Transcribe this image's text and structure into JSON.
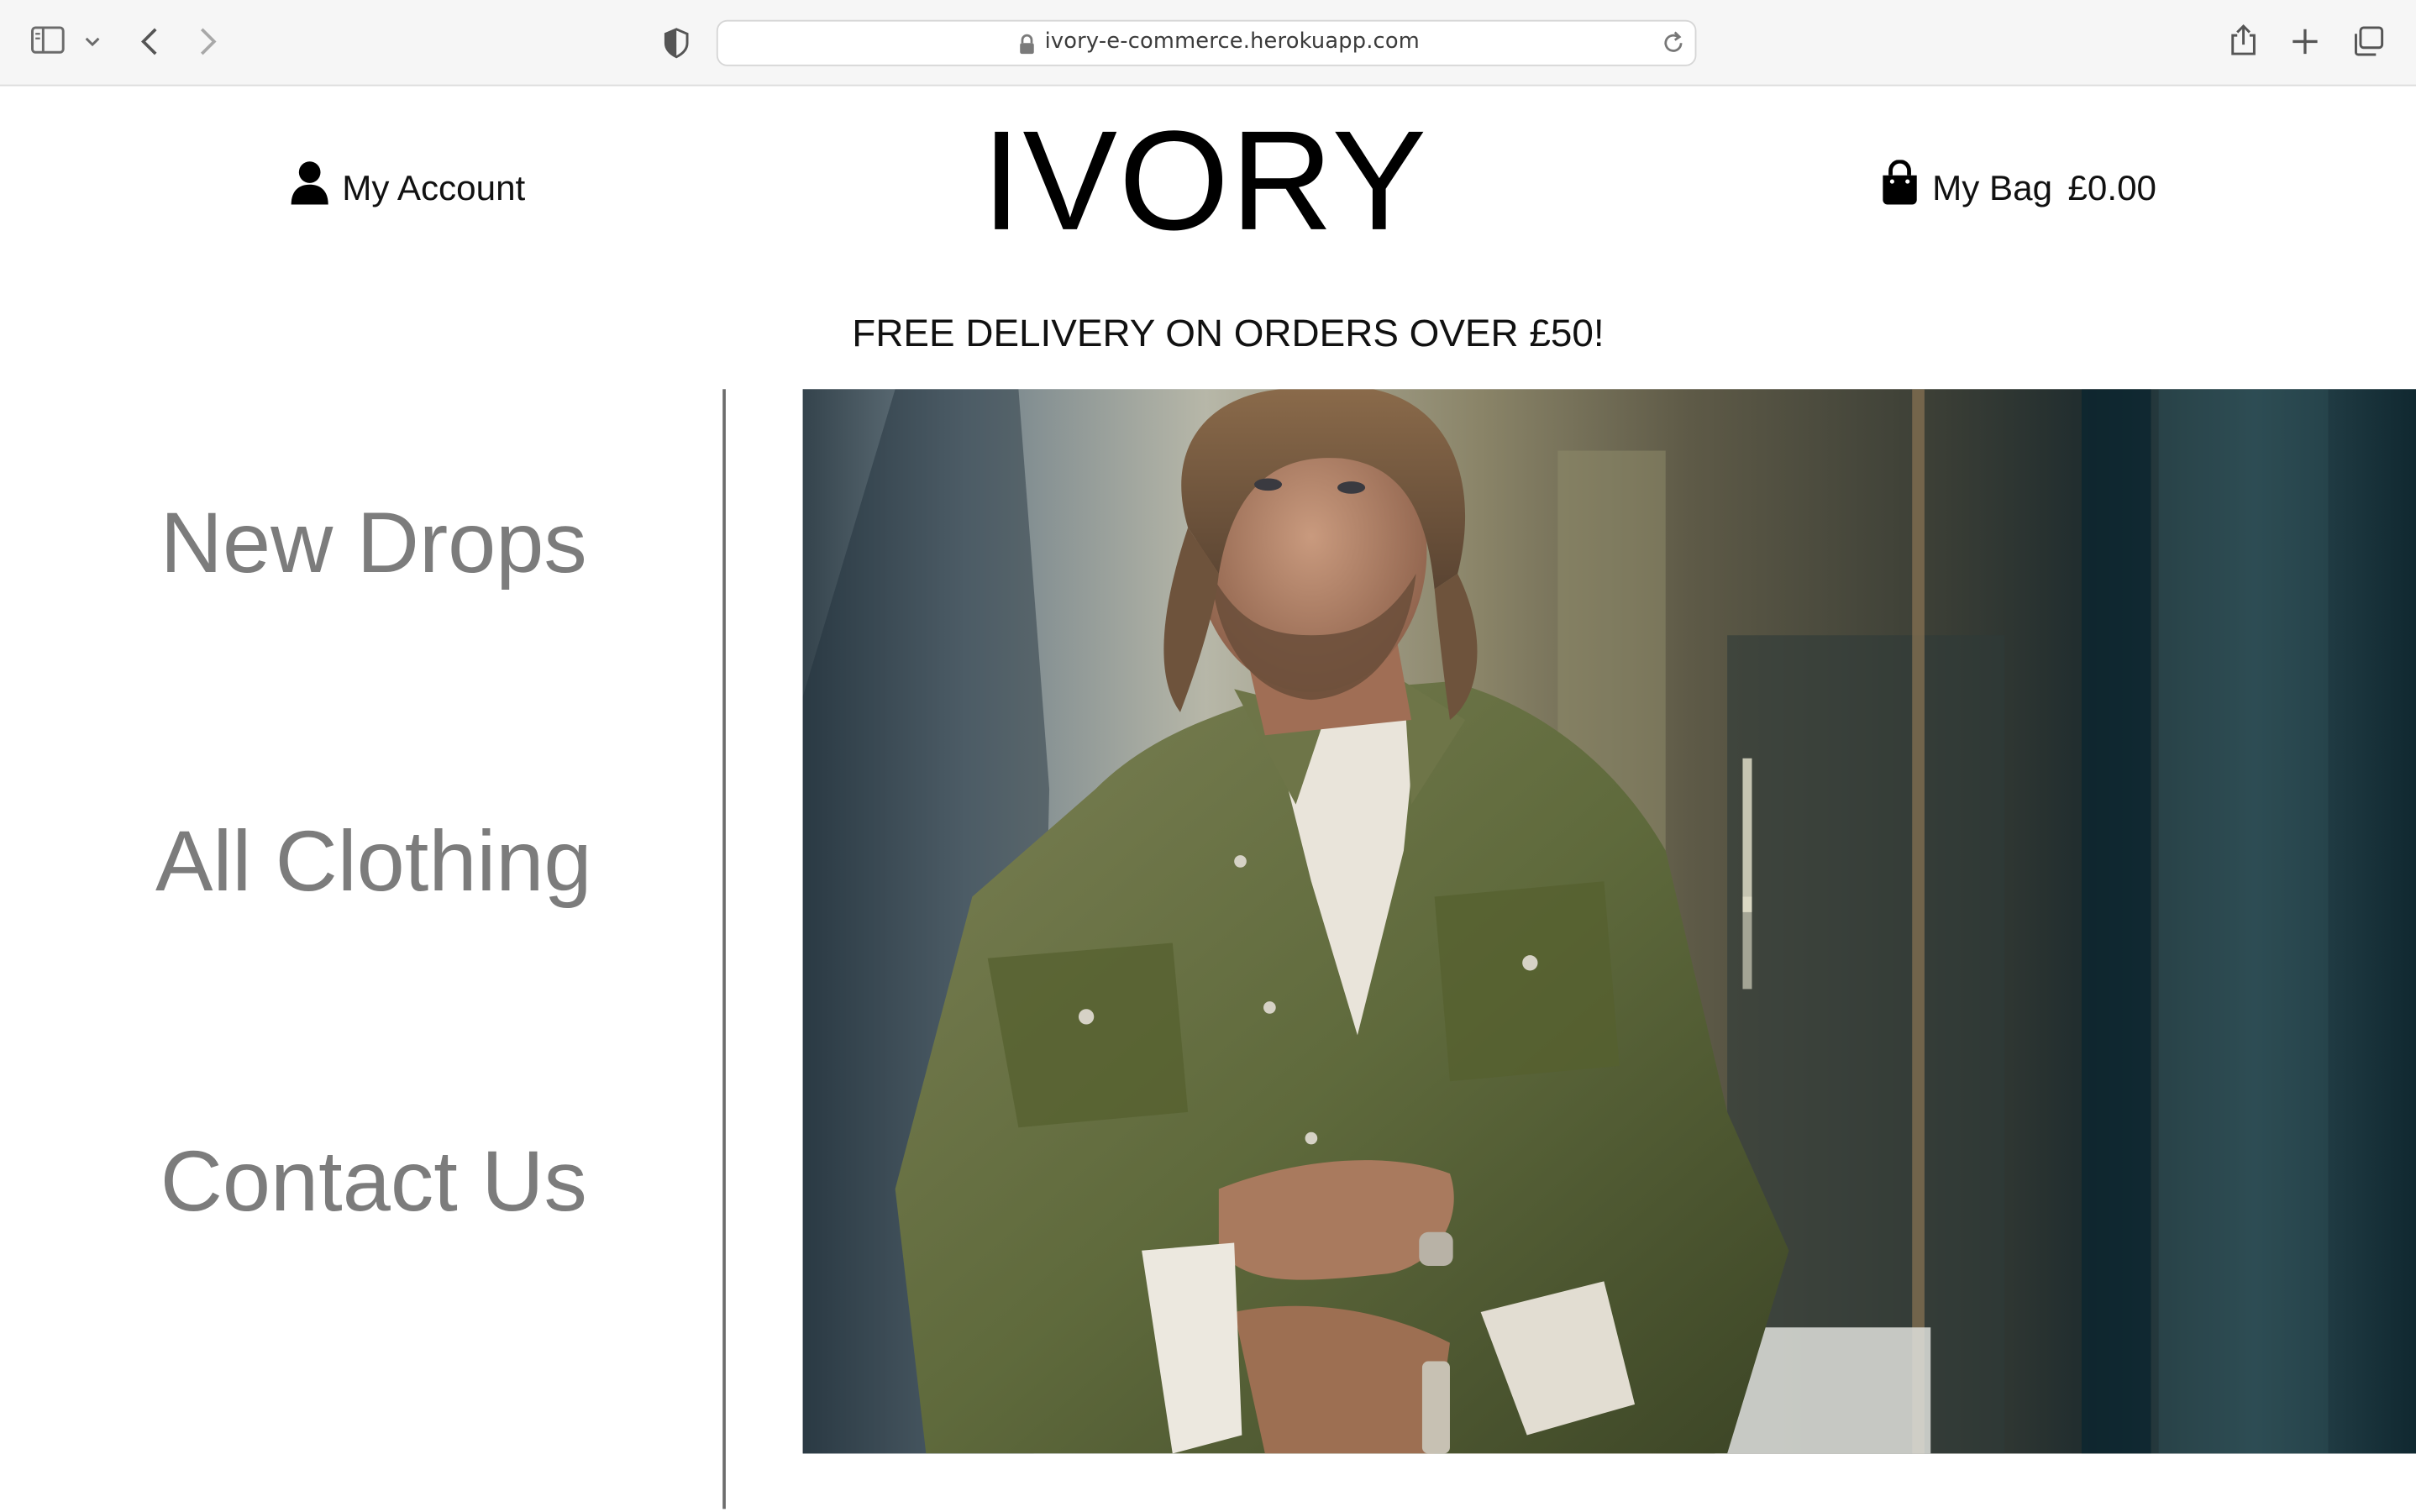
{
  "browser": {
    "url": "ivory-e-commerce.herokuapp.com"
  },
  "header": {
    "account_label": "My Account",
    "logo": "IVORY",
    "bag_label": "My Bag",
    "bag_total": "£0.00"
  },
  "promo": {
    "text": "FREE DELIVERY ON ORDERS OVER £50!"
  },
  "nav": {
    "items": [
      {
        "label": "New Drops"
      },
      {
        "label": "All Clothing"
      },
      {
        "label": "Contact Us"
      }
    ]
  },
  "hero": {
    "icon": "hero-photo"
  }
}
